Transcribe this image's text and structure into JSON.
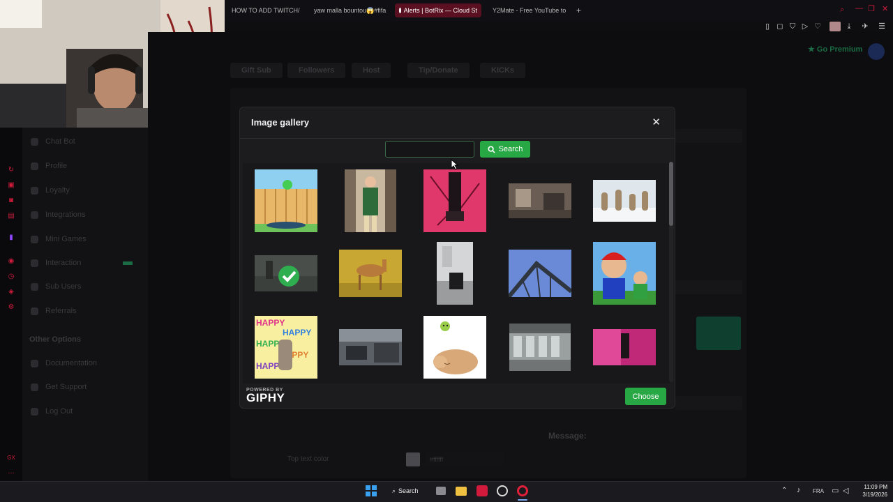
{
  "browser": {
    "tabs": [
      {
        "label": "HOW TO ADD TWITCH/ Ki",
        "color": "#d21b3c"
      },
      {
        "label": "yaw malla bountou😱#fifa",
        "color": "#e23030"
      },
      {
        "label": "Alerts | BotRix — Cloud St",
        "color": "#ffffff"
      },
      {
        "label": "Y2Mate - Free YouTube to",
        "color": "#eeeeee"
      }
    ],
    "new_tab_label": "+"
  },
  "site": {
    "premium_label": "Go Premium",
    "alert_tabs": [
      "Gift Sub",
      "Followers",
      "Host",
      "Tip/Donate",
      "KICKs"
    ],
    "sidebar_items": [
      "Chat Bot",
      "Profile",
      "Loyalty",
      "Integrations",
      "Mini Games",
      "Interaction",
      "Sub Users",
      "Referrals"
    ],
    "other_options_heading": "Other Options",
    "other_items": [
      "Documentation",
      "Get Support",
      "Log Out"
    ],
    "message_label": "Message:",
    "top_text_color_label": "Top text color",
    "top_text_color_value": "#ffffff"
  },
  "modal": {
    "title": "Image gallery",
    "close_icon": "close-icon",
    "search_placeholder": "",
    "search_value": "",
    "search_button_label": "Search",
    "choose_button_label": "Choose",
    "powered_by_label": "POWERED BY",
    "giphy_logo_label": "GIPHY"
  },
  "taskbar": {
    "search_label": "Search",
    "language": "FRA",
    "time": "11:09 PM",
    "date": "3/19/2026"
  }
}
